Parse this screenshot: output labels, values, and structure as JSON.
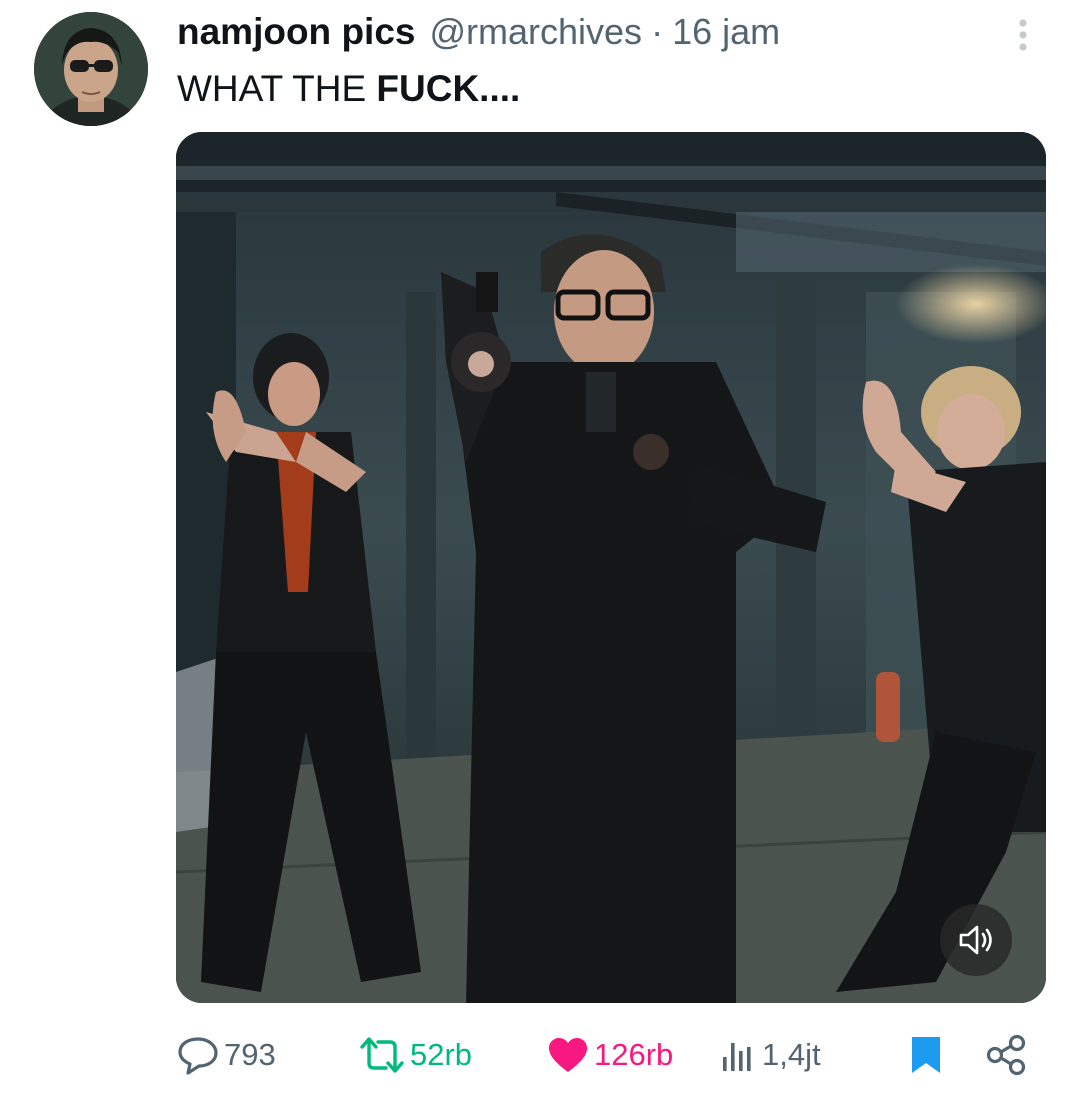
{
  "tweet": {
    "display_name": "namjoon pics",
    "handle": "@rmarchives",
    "separator": "·",
    "time": "16 jam",
    "text_normal": "WHAT THE ",
    "text_bold": "FUCK",
    "text_trailing": "...."
  },
  "media": {
    "type": "video",
    "description_icon": "volume-icon"
  },
  "actions": {
    "replies": "793",
    "retweets": "52rb",
    "likes": "126rb",
    "views": "1,4jt"
  },
  "colors": {
    "text_primary": "#0f1419",
    "text_secondary": "#536471",
    "retweet": "#00ba7c",
    "like": "#f91880",
    "bookmark": "#1d9bf0"
  }
}
